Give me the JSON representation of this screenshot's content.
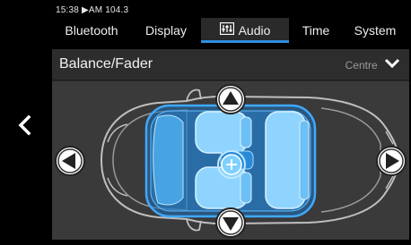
{
  "status": {
    "text": "15:38 ▶AM 104.3"
  },
  "tabs": [
    {
      "label": "Bluetooth",
      "active": false
    },
    {
      "label": "Display",
      "active": false
    },
    {
      "label": "Audio",
      "active": true,
      "icon": "equalizer-icon"
    },
    {
      "label": "Time",
      "active": false
    },
    {
      "label": "System",
      "active": false
    }
  ],
  "panel": {
    "title": "Balance/Fader",
    "preset": "Centre"
  },
  "colors": {
    "accent": "#2f8fe0",
    "seat": "#8fd4ff",
    "cabin": "#1d6fb8"
  },
  "icons": {
    "back": "chevron-left-icon",
    "up": "arrow-up-icon",
    "down": "arrow-down-icon",
    "left": "arrow-left-icon",
    "right": "arrow-right-icon",
    "center": "plus-icon",
    "dropdown": "chevron-down-icon"
  }
}
